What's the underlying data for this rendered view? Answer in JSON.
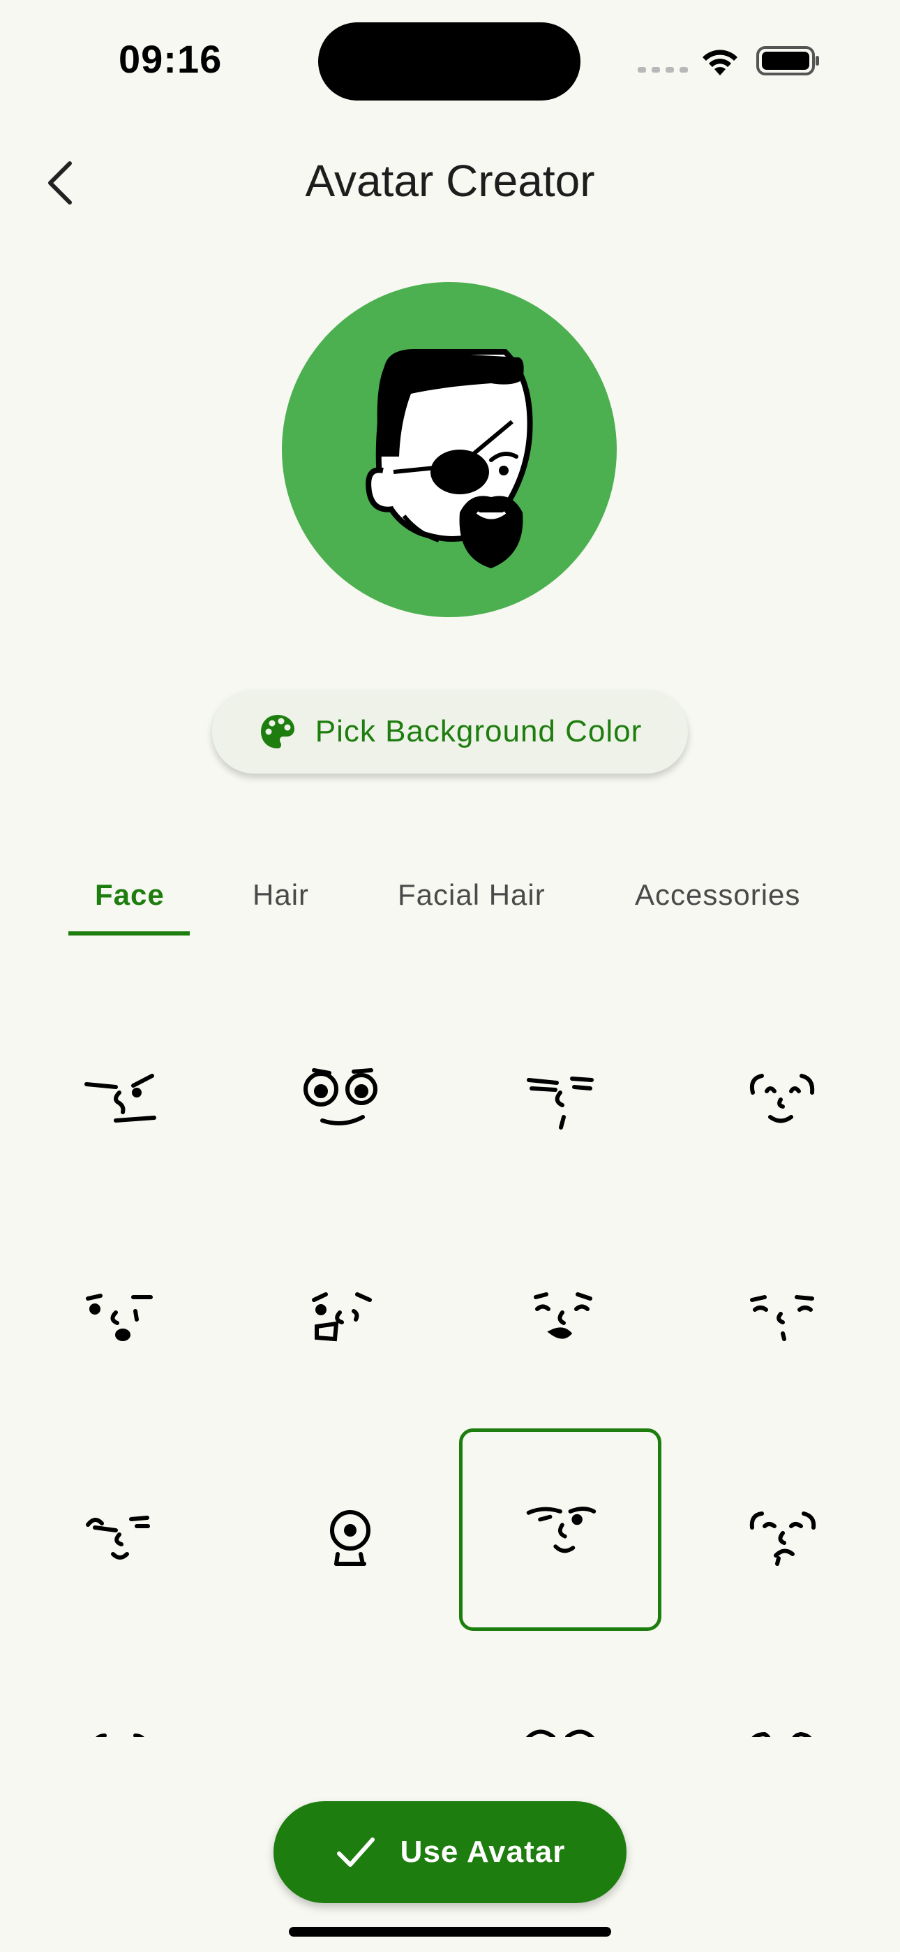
{
  "status_bar": {
    "time": "09:16"
  },
  "header": {
    "title": "Avatar Creator",
    "back_icon": "chevron-left-icon"
  },
  "preview": {
    "background_color": "#4caf50"
  },
  "pick_color": {
    "label": "Pick Background Color",
    "icon": "palette-icon"
  },
  "tabs": [
    {
      "label": "Face",
      "active": true
    },
    {
      "label": "Hair",
      "active": false
    },
    {
      "label": "Facial Hair",
      "active": false
    },
    {
      "label": "Accessories",
      "active": false
    }
  ],
  "face_options": {
    "selected_index": 10,
    "count_visible": 16
  },
  "use_button": {
    "label": "Use Avatar",
    "icon": "check-icon"
  },
  "colors": {
    "accent": "#1e7d0f",
    "background": "#f7f8f1",
    "preview": "#4caf50"
  }
}
